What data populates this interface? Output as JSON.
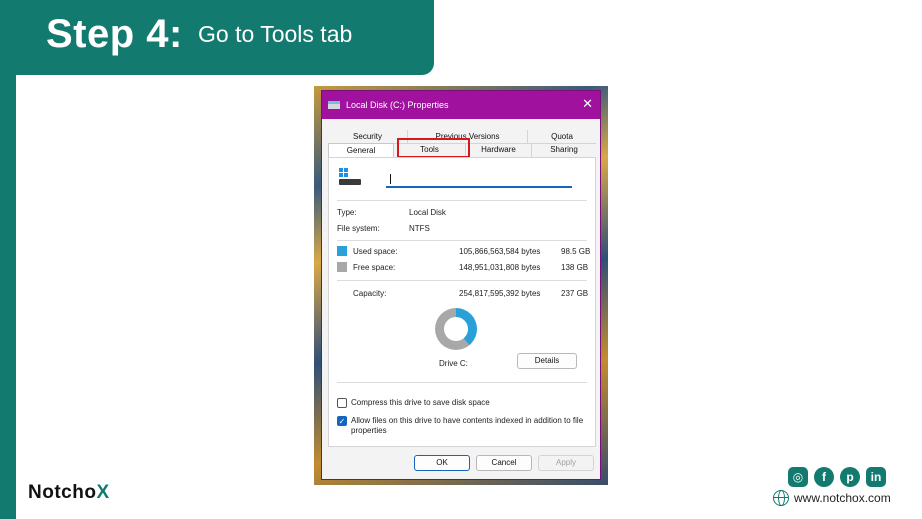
{
  "slide": {
    "step_number": "Step 4:",
    "step_text": "Go to Tools tab",
    "brand_main": "Notcho",
    "brand_x": "X",
    "website": "www.notchox.com",
    "accent_color": "#137a70",
    "social_icons": [
      "instagram-icon",
      "facebook-icon",
      "pinterest-icon",
      "linkedin-icon"
    ]
  },
  "dialog": {
    "title": "Local Disk (C:) Properties",
    "tabs_top": [
      "Security",
      "Previous Versions",
      "Quota"
    ],
    "tabs_bottom": [
      "General",
      "Tools",
      "Hardware",
      "Sharing"
    ],
    "active_tab": "General",
    "highlighted_tab": "Tools",
    "highlight_color": "#d41a1a",
    "titlebar_color": "#a0129e",
    "name_value": "",
    "type_label": "Type:",
    "type_value": "Local Disk",
    "fs_label": "File system:",
    "fs_value": "NTFS",
    "used_label": "Used space:",
    "used_bytes": "105,866,563,584 bytes",
    "used_gb": "98.5 GB",
    "used_color": "#2aa0d8",
    "free_label": "Free space:",
    "free_bytes": "148,951,031,808 bytes",
    "free_gb": "138 GB",
    "free_color": "#a8a8a8",
    "capacity_label": "Capacity:",
    "capacity_bytes": "254,817,595,392 bytes",
    "capacity_gb": "237 GB",
    "drive_label": "Drive C:",
    "details_label": "Details",
    "compress_label": "Compress this drive to save disk space",
    "compress_checked": false,
    "index_label": "Allow files on this drive to have contents indexed in addition to file properties",
    "index_checked": true,
    "ok_label": "OK",
    "cancel_label": "Cancel",
    "apply_label": "Apply"
  }
}
